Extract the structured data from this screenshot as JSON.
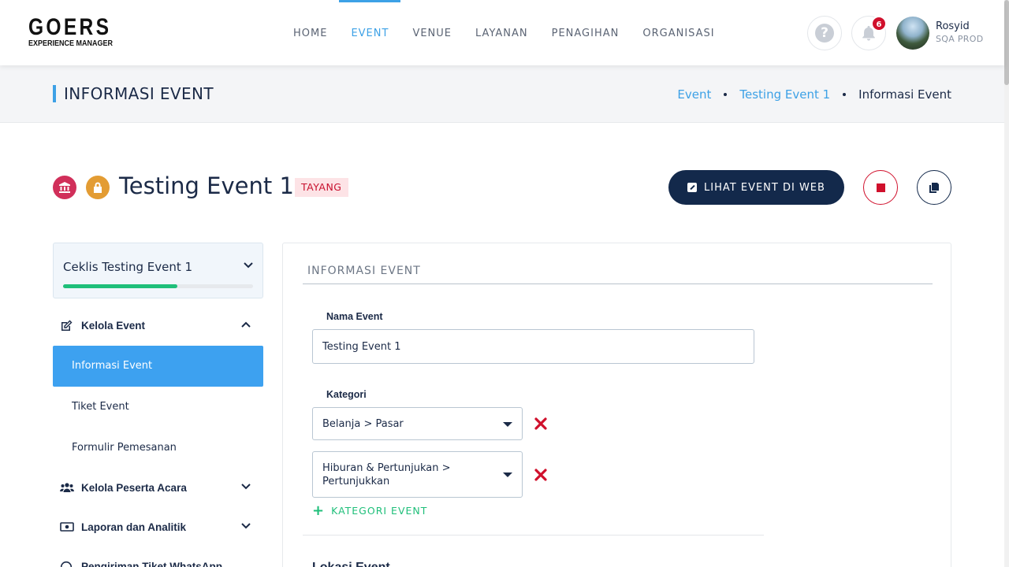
{
  "brand": {
    "name": "GOERS",
    "tagline": "EXPERIENCE MANAGER"
  },
  "nav": [
    {
      "label": "HOME",
      "active": false
    },
    {
      "label": "EVENT",
      "active": true
    },
    {
      "label": "VENUE",
      "active": false
    },
    {
      "label": "LAYANAN",
      "active": false
    },
    {
      "label": "PENAGIHAN",
      "active": false
    },
    {
      "label": "ORGANISASI",
      "active": false
    }
  ],
  "header": {
    "help_icon": "question-circle-icon",
    "bell_icon": "bell-icon",
    "notification_count": "6",
    "user": {
      "name": "Rosyid",
      "role": "SQA PROD"
    }
  },
  "titlebar": {
    "title": "INFORMASI EVENT",
    "breadcrumb": [
      "Event",
      "Testing Event 1",
      "Informasi Event"
    ]
  },
  "event": {
    "title": "Testing Event 1",
    "status": "TAYANG",
    "icons": [
      "bank-icon",
      "lock-icon"
    ],
    "web_button": "LIHAT EVENT DI WEB",
    "stop_icon": "stop-icon",
    "copy_icon": "copy-icon"
  },
  "sidebar": {
    "checklist": {
      "title": "Ceklis Testing Event 1",
      "progress": 0.6
    },
    "groups": [
      {
        "label": "Kelola Event",
        "icon": "edit-icon",
        "expanded": true,
        "items": [
          {
            "label": "Informasi Event",
            "active": true
          },
          {
            "label": "Tiket Event",
            "active": false
          },
          {
            "label": "Formulir Pemesanan",
            "active": false
          }
        ]
      },
      {
        "label": "Kelola Peserta Acara",
        "icon": "users-icon",
        "expanded": false
      },
      {
        "label": "Laporan dan Analitik",
        "icon": "money-icon",
        "expanded": false
      },
      {
        "label": "Pengiriman Tiket WhatsApp",
        "icon": "whatsapp-icon",
        "expanded": false
      }
    ]
  },
  "form": {
    "section_title": "INFORMASI EVENT",
    "nama_label": "Nama Event",
    "nama_value": "Testing Event 1",
    "kategori_label": "Kategori",
    "kategori": [
      "Belanja > Pasar",
      "Hiburan & Pertunjukan > Pertunjukkan"
    ],
    "add_kategori": "KATEGORI EVENT",
    "next_section": "Lokasi Event"
  },
  "colors": {
    "accent": "#3da1e6",
    "navy": "#13294b",
    "danger": "#d0102c",
    "success": "#1fbf7a"
  }
}
